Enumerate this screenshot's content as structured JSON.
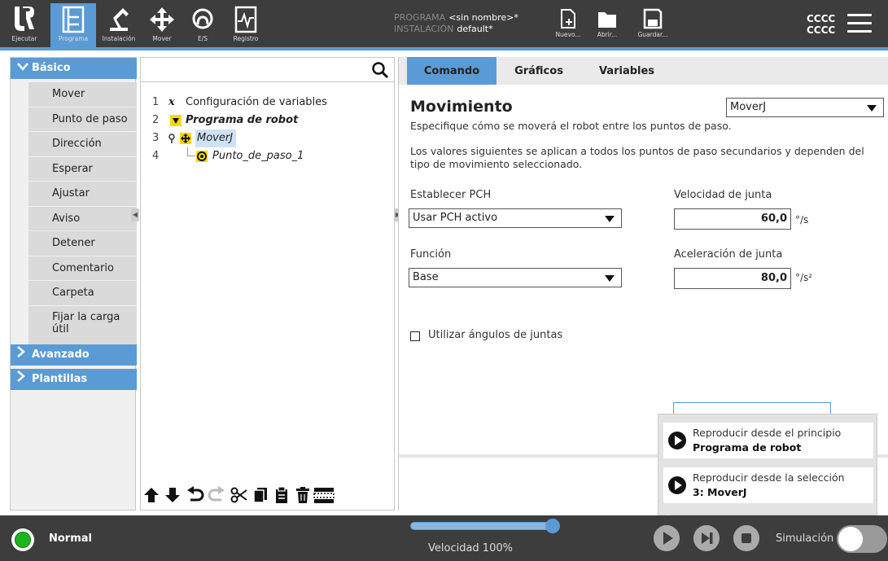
{
  "header": {
    "nav": [
      {
        "label": "Ejecutar",
        "icon": "ur-logo-icon"
      },
      {
        "label": "Programa",
        "icon": "program-tree-icon",
        "active": true
      },
      {
        "label": "Instalación",
        "icon": "robot-arm-icon"
      },
      {
        "label": "Mover",
        "icon": "move-arrows-icon"
      },
      {
        "label": "E/S",
        "icon": "io-icon"
      },
      {
        "label": "Registro",
        "icon": "log-icon"
      }
    ],
    "program_label": "PROGRAMA",
    "program_value": "<sin nombre>*",
    "install_label": "INSTALACIÓN",
    "install_value": "default*",
    "files": [
      {
        "label": "Nuevo...",
        "icon": "new-file-icon"
      },
      {
        "label": "Abrir...",
        "icon": "open-folder-icon"
      },
      {
        "label": "Guardar...",
        "icon": "save-icon"
      }
    ],
    "user_line1": "CCCC",
    "user_line2": "CCCC"
  },
  "library": {
    "basic": "Básico",
    "items": [
      "Mover",
      "Punto de paso",
      "Dirección",
      "Esperar",
      "Ajustar",
      "Aviso",
      "Detener",
      "Comentario",
      "Carpeta",
      "Fijar la carga útil"
    ],
    "advanced": "Avanzado",
    "templates": "Plantillas"
  },
  "tree": {
    "search_placeholder": "",
    "rows": [
      {
        "num": "1",
        "text": "Configuración de variables"
      },
      {
        "num": "2",
        "text": "Programa de robot"
      },
      {
        "num": "3",
        "text": "MoverJ"
      },
      {
        "num": "4",
        "text": "Punto_de_paso_1"
      }
    ]
  },
  "panel": {
    "tabs": [
      "Comando",
      "Gráficos",
      "Variables"
    ],
    "title": "Movimiento",
    "move_type": "MoverJ",
    "subtitle": "Especifique cómo se moverá el robot entre los puntos de paso.",
    "description": "Los valores siguientes se aplican a todos los puntos de paso secundarios y dependen del tipo de movimiento seleccionado.",
    "tcp_label": "Establecer PCH",
    "tcp_value": "Usar PCH activo",
    "feature_label": "Función",
    "feature_value": "Base",
    "joint_speed_label": "Velocidad de junta",
    "joint_speed_value": "60,0",
    "joint_speed_unit": "°/s",
    "joint_accel_label": "Aceleración de junta",
    "joint_accel_value": "80,0",
    "joint_accel_unit": "°/s²",
    "joint_angles_label": "Utilizar ángulos de juntas"
  },
  "popup": {
    "opt1_line1": "Reproducir desde el principio",
    "opt1_line2": "Programa de robot",
    "opt2_line1": "Reproducir desde la selección",
    "opt2_line2": "3: MoverJ"
  },
  "footer": {
    "status": "Normal",
    "speed": "Velocidad 100%",
    "speed_fraction": 1.0,
    "simulation": "Simulación"
  },
  "colors": {
    "accent": "#5b9bd5",
    "header_bg": "#3d3d3d",
    "status_ok": "#1db51d",
    "highlight": "#ffd700"
  }
}
